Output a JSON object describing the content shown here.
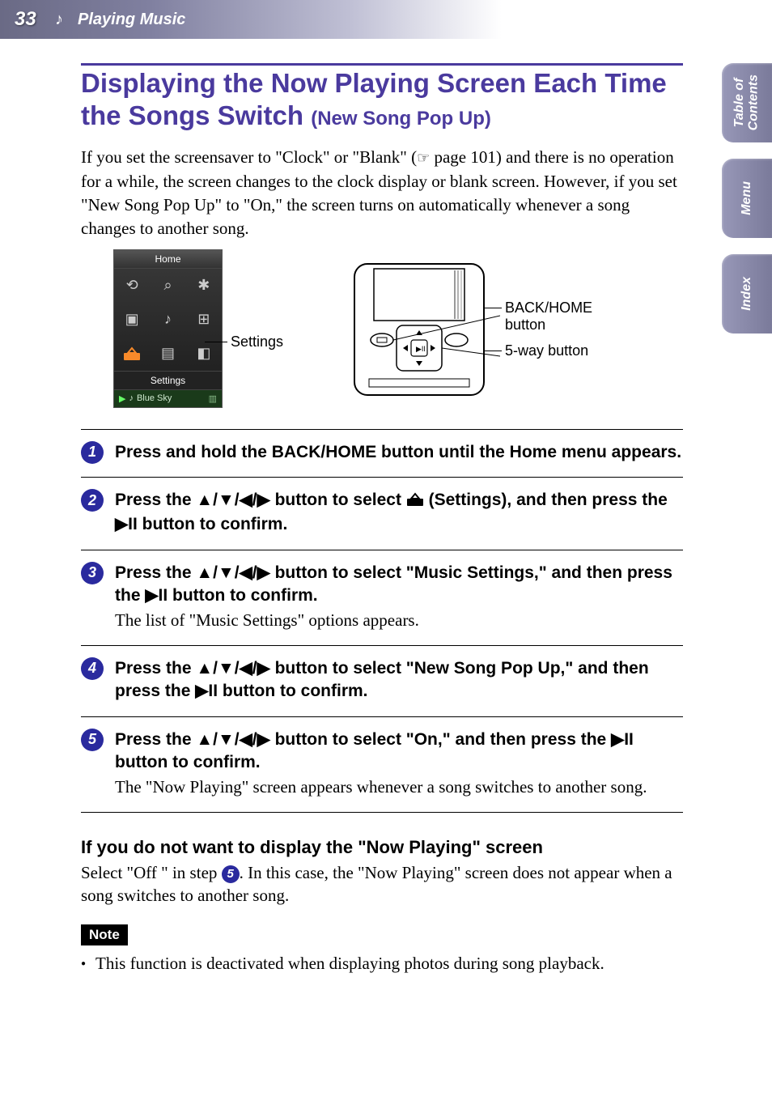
{
  "header": {
    "page_number": "33",
    "section": "Playing Music"
  },
  "side_tabs": {
    "toc": "Table of\nContents",
    "menu": "Menu",
    "index": "Index"
  },
  "title": {
    "main": "Displaying the Now Playing Screen Each Time the Songs Switch ",
    "sub": "(New Song Pop Up)"
  },
  "intro": {
    "part1": "If you set the screensaver to \"Clock\" or \"Blank\" (",
    "pageref": " page 101) and there is no operation for a while, the screen changes to the clock display or blank screen. However, if you set \"New Song Pop Up\" to \"On,\" the screen turns on automatically whenever a song changes to another song."
  },
  "diagram": {
    "home_title": "Home",
    "settings_row": "Settings",
    "now_playing_track": "Blue Sky",
    "label_settings": "Settings",
    "label_backhome": "BACK/HOME button",
    "label_fiveway": "5-way button"
  },
  "steps": {
    "s1": {
      "num": "1",
      "head": "Press and hold the BACK/HOME button until the Home menu appears."
    },
    "s2": {
      "num": "2",
      "head_a": "Press the ",
      "head_arrows": "▲/▼/◀/▶",
      "head_b": " button to select ",
      "head_c": " (Settings), and then press the ",
      "head_play": "▶II",
      "head_d": " button to confirm."
    },
    "s3": {
      "num": "3",
      "head_a": "Press the ",
      "head_arrows": "▲/▼/◀/▶",
      "head_b": " button to select \"Music Settings,\" and then press the ",
      "head_play": "▶II",
      "head_c": " button to confirm.",
      "body": "The list of \"Music Settings\" options appears."
    },
    "s4": {
      "num": "4",
      "head_a": "Press the ",
      "head_arrows": "▲/▼/◀/▶",
      "head_b": " button to select \"New Song Pop Up,\" and then press the ",
      "head_play": "▶II",
      "head_c": " button to confirm."
    },
    "s5": {
      "num": "5",
      "head_a": "Press the ",
      "head_arrows": "▲/▼/◀/▶",
      "head_b": " button to select \"On,\" and then press the ",
      "head_play": "▶II",
      "head_c": " button to confirm.",
      "body": "The \"Now Playing\" screen appears whenever a song switches to another song."
    }
  },
  "subsection": {
    "head": "If you do not want to display the \"Now Playing\" screen",
    "body_a": "Select \"Off \" in step ",
    "body_num": "5",
    "body_b": ". In this case, the \"Now Playing\" screen does not appear when a song switches to another song."
  },
  "note": {
    "tag": "Note",
    "item1": "This function is deactivated when displaying photos during song playback."
  }
}
